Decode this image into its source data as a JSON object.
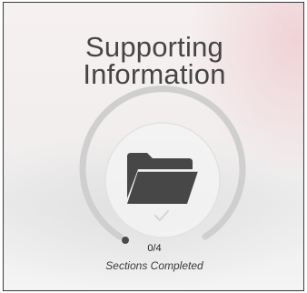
{
  "card": {
    "title": "Supporting Information",
    "icon": "folder-icon",
    "status_icon": "checkmark-icon",
    "progress": {
      "completed": 0,
      "total": 4,
      "text": "0/4"
    },
    "caption": "Sections Completed"
  },
  "colors": {
    "ring_track": "#cfcfcf",
    "ring_inner": "#f3f3f3",
    "folder": "#474747",
    "check": "#d5d5d5",
    "title": "#454545"
  }
}
